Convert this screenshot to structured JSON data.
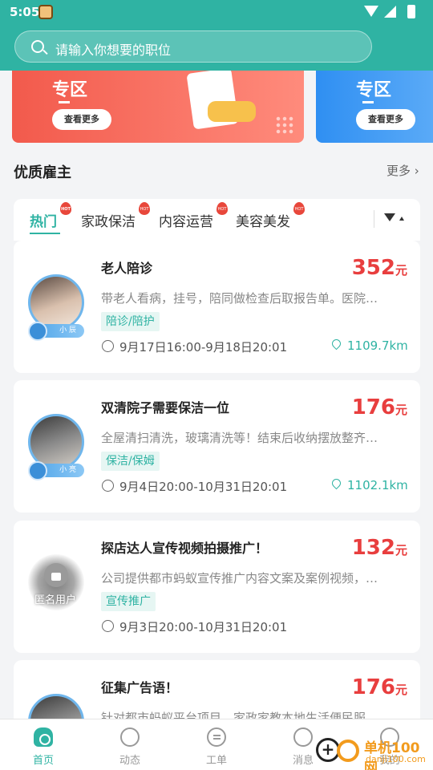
{
  "status_bar": {
    "time": "5:05"
  },
  "search": {
    "placeholder": "请输入你想要的职位"
  },
  "banners": [
    {
      "zone": "专区",
      "button": "查看更多"
    },
    {
      "zone": "专区",
      "button": "查看更多"
    }
  ],
  "section": {
    "title": "优质雇主",
    "more": "更多 ›"
  },
  "tabs": {
    "items": [
      {
        "label": "热门",
        "hot": "HOT"
      },
      {
        "label": "家政保洁",
        "hot": "HOT"
      },
      {
        "label": "内容运营",
        "hot": "HOT"
      },
      {
        "label": "美容美发",
        "hot": "HOT"
      }
    ]
  },
  "jobs": [
    {
      "title": "老人陪诊",
      "price": "352",
      "unit": "元",
      "desc": "带老人看病，挂号，陪同做检查后取报告单。医院…",
      "tag": "陪诊/陪护",
      "time": "9月17日16:00-9月18日20:01",
      "distance": "1109.7km",
      "level": "小 辰"
    },
    {
      "title": "双清院子需要保洁一位",
      "price": "176",
      "unit": "元",
      "desc": "全屋清扫清洗，玻璃清洗等！结束后收纳摆放整齐…",
      "tag": "保洁/保姆",
      "time": "9月4日20:00-10月31日20:01",
      "distance": "1102.1km",
      "level": "小 亮"
    },
    {
      "title": "探店达人宣传视频拍摄推广！",
      "price": "132",
      "unit": "元",
      "desc": "公司提供都市蚂蚁宣传推广内容文案及案例视频，…",
      "tag": "宣传推广",
      "time": "9月3日20:00-10月31日20:01",
      "anon": "匿名用户"
    },
    {
      "title": "征集广告语！",
      "price": "176",
      "unit": "元",
      "desc": "针对都市蚂蚁平台项目，家政家教本地生活便民服"
    }
  ],
  "bottom_nav": [
    {
      "label": "首页"
    },
    {
      "label": "动态"
    },
    {
      "label": "工单"
    },
    {
      "label": "消息"
    },
    {
      "label": "我的"
    }
  ],
  "watermark": {
    "name": "单机100网",
    "url": "danji100.com"
  },
  "colors": {
    "primary": "#2fb3a3",
    "price": "#e83e3e",
    "banner_red": "#f25a4c",
    "banner_blue": "#2f8ff2"
  }
}
